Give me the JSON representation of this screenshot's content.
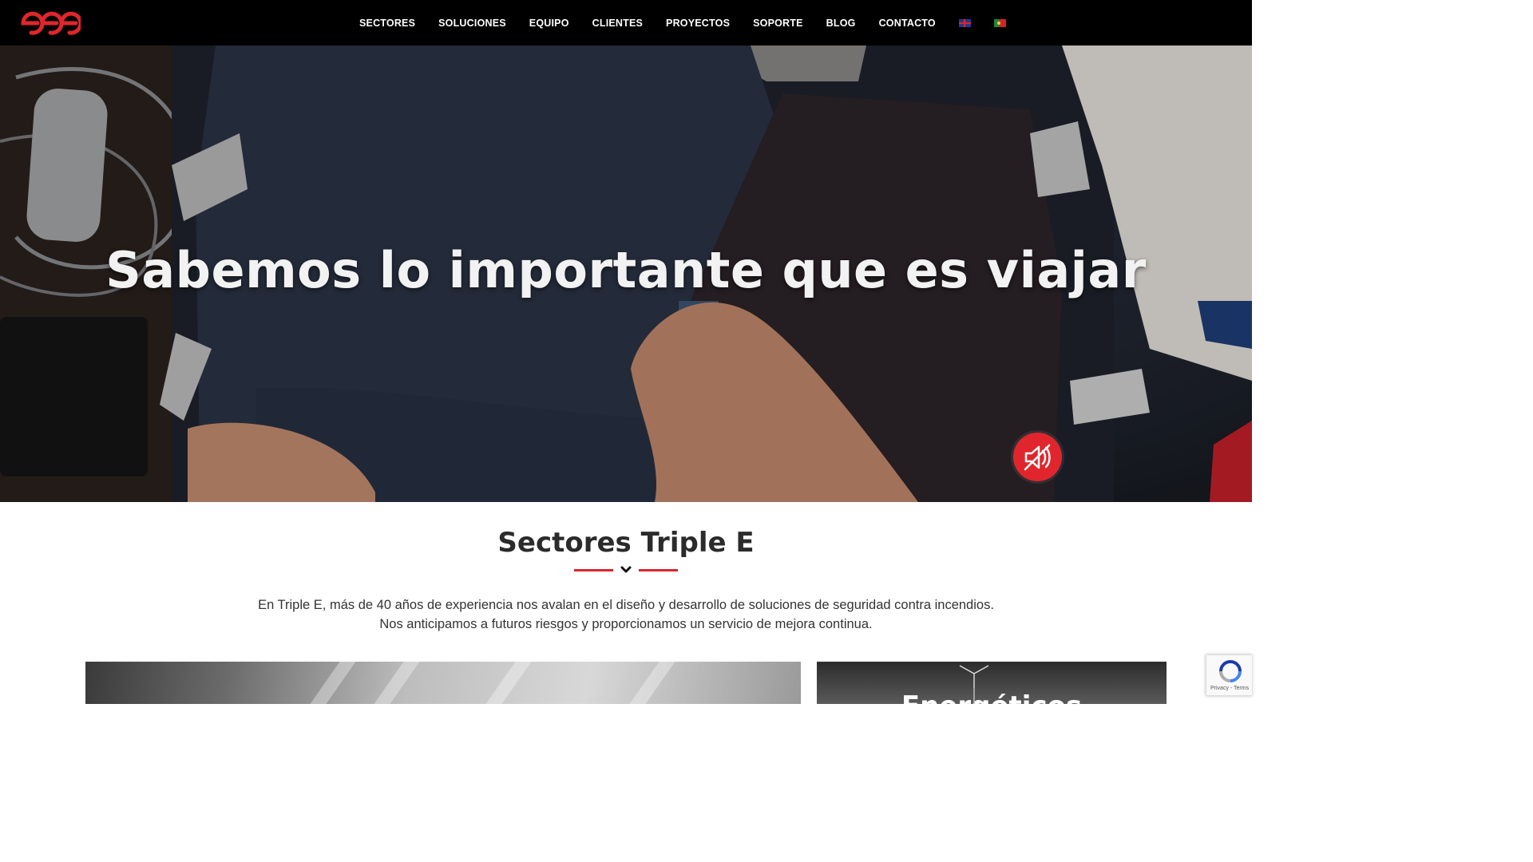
{
  "brand": {
    "logo_icon": "triple-e-logo",
    "accent": "#e0262c"
  },
  "nav": {
    "items": [
      "SECTORES",
      "SOLUCIONES",
      "EQUIPO",
      "CLIENTES",
      "PROYECTOS",
      "SOPORTE",
      "BLOG",
      "CONTACTO"
    ],
    "languages": [
      "english-flag-icon",
      "portuguese-flag-icon"
    ]
  },
  "hero": {
    "title": "Sabemos lo importante que es viajar",
    "mute_icon": "sound-off-icon"
  },
  "sectores": {
    "title": "Sectores Triple E",
    "intro_line1": "En Triple E, más de 40 años de experiencia nos avalan en el diseño y desarrollo de soluciones de seguridad contra incendios.",
    "intro_line2": "Nos anticipamos a futuros riesgos y proporcionamos un servicio de mejora continua.",
    "cards": [
      {
        "title": ""
      },
      {
        "title": "Energéticos"
      }
    ]
  },
  "recaptcha": {
    "links": "Privacy - Terms"
  }
}
